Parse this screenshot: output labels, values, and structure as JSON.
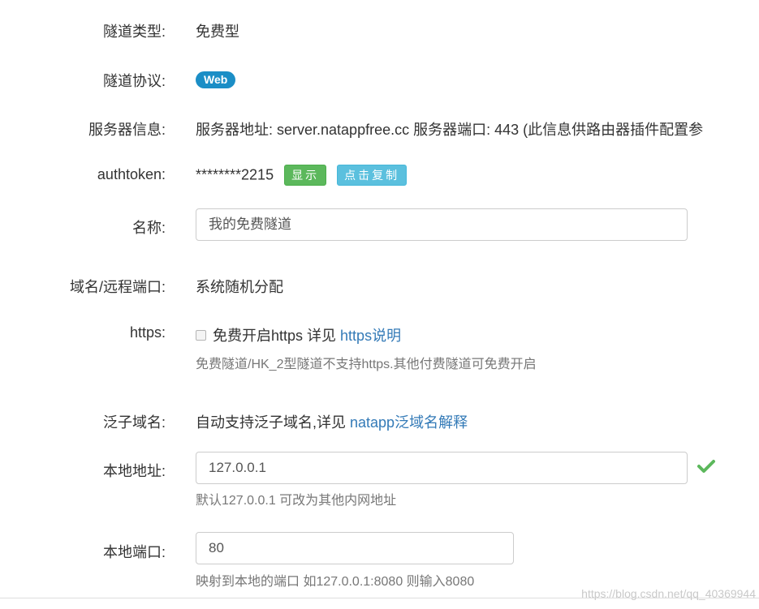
{
  "tunnel_type": {
    "label": "隧道类型:",
    "value": "免费型"
  },
  "protocol": {
    "label": "隧道协议:",
    "badge": "Web"
  },
  "server_info": {
    "label": "服务器信息:",
    "value": "服务器地址: server.natappfree.cc 服务器端口: 443 (此信息供路由器插件配置参"
  },
  "authtoken": {
    "label": "authtoken:",
    "value": "********2215",
    "show_button": "显示",
    "copy_button": "点击复制"
  },
  "name": {
    "label": "名称:",
    "value": "我的免费隧道"
  },
  "domain": {
    "label": "域名/远程端口:",
    "value": "系统随机分配"
  },
  "https": {
    "label": "https:",
    "checkbox_label": "免费开启https 详见",
    "link": "https说明",
    "help": "免费隧道/HK_2型隧道不支持https.其他付费隧道可免费开启"
  },
  "wildcard": {
    "label": "泛子域名:",
    "text": "自动支持泛子域名,详见",
    "link": "natapp泛域名解释"
  },
  "local_address": {
    "label": "本地地址:",
    "value": "127.0.0.1",
    "help": "默认127.0.0.1 可改为其他内网地址",
    "valid_icon": "check-icon",
    "valid_color": "#5cb85c"
  },
  "local_port": {
    "label": "本地端口:",
    "value": "80",
    "help": "映射到本地的端口 如127.0.0.1:8080 则输入8080"
  },
  "watermark": "https://blog.csdn.net/qq_40369944",
  "colors": {
    "link": "#337ab7",
    "badge": "#1b8ec6",
    "show_button": "#5cb85c",
    "copy_button": "#5bc0de"
  }
}
